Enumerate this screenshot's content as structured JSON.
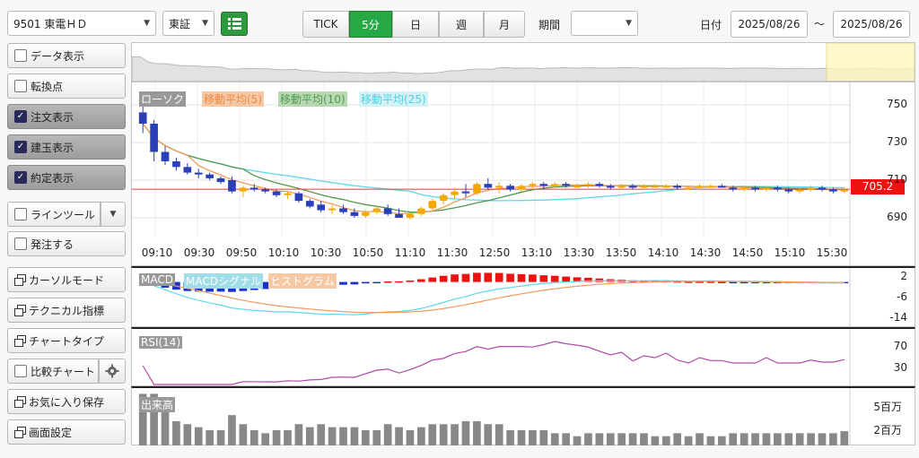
{
  "toolbar": {
    "stock_select": "9501 東電ＨＤ",
    "market_select": "東証",
    "period_label": "期間",
    "period_select": "",
    "date_label": "日付",
    "date_from": "2025/08/26",
    "date_sep": "〜",
    "date_to": "2025/08/26",
    "interval_tabs": [
      {
        "label": "TICK",
        "active": false
      },
      {
        "label": "5分",
        "active": true
      },
      {
        "label": "日",
        "active": false
      },
      {
        "label": "週",
        "active": false
      },
      {
        "label": "月",
        "active": false
      }
    ]
  },
  "sidebar": {
    "data_display": "データ表示",
    "turning_point": "転換点",
    "order_display": "注文表示",
    "position_display": "建玉表示",
    "execution_display": "約定表示",
    "line_tool": "ラインツール",
    "place_order": "発注する",
    "cursor_mode": "カーソルモード",
    "technical_indicator": "テクニカル指標",
    "chart_type": "チャートタイプ",
    "compare_chart": "比較チャート",
    "save_favorite": "お気に入り保存",
    "screen_settings": "画面設定"
  },
  "colors": {
    "up": "#f5a800",
    "down": "#2b3fb8",
    "ma5": "#f39a5a",
    "ma10": "#4e9a4e",
    "ma25": "#5fd8e8",
    "price_line": "#e03a3a",
    "rsi": "#b04aa6",
    "volume": "#888888"
  },
  "chart_data": [
    {
      "type": "candlestick",
      "title": "",
      "legend": [
        "ローソク",
        "移動平均(5)",
        "移動平均(10)",
        "移動平均(25)"
      ],
      "x_ticks": [
        "09:10",
        "09:30",
        "09:50",
        "10:10",
        "10:30",
        "10:50",
        "11:10",
        "11:30",
        "12:50",
        "13:10",
        "13:30",
        "13:50",
        "14:10",
        "14:30",
        "14:50",
        "15:10",
        "15:30"
      ],
      "y_ticks": [
        750,
        730,
        710,
        690
      ],
      "ylim": [
        680,
        760
      ],
      "current_price": "705.2",
      "ohlc": [
        [
          746,
          750,
          735,
          740
        ],
        [
          740,
          742,
          720,
          725
        ],
        [
          725,
          728,
          718,
          720
        ],
        [
          720,
          722,
          715,
          717
        ],
        [
          717,
          719,
          713,
          714
        ],
        [
          714,
          716,
          711,
          713
        ],
        [
          713,
          714,
          710,
          711
        ],
        [
          711,
          712,
          708,
          709
        ],
        [
          710,
          712,
          703,
          704
        ],
        [
          704,
          707,
          701,
          706
        ],
        [
          706,
          708,
          704,
          705
        ],
        [
          705,
          706,
          703,
          704
        ],
        [
          704,
          705,
          701,
          702
        ],
        [
          702,
          704,
          700,
          703
        ],
        [
          703,
          704,
          698,
          699
        ],
        [
          699,
          700,
          695,
          696
        ],
        [
          697,
          699,
          693,
          694
        ],
        [
          694,
          697,
          692,
          695
        ],
        [
          695,
          697,
          692,
          693
        ],
        [
          693,
          695,
          690,
          691
        ],
        [
          691,
          694,
          690,
          693
        ],
        [
          693,
          696,
          692,
          695
        ],
        [
          695,
          697,
          691,
          692
        ],
        [
          692,
          695,
          690,
          690
        ],
        [
          690,
          693,
          689,
          692
        ],
        [
          692,
          696,
          691,
          695
        ],
        [
          695,
          700,
          694,
          699
        ],
        [
          699,
          703,
          697,
          702
        ],
        [
          702,
          706,
          700,
          704
        ],
        [
          704,
          708,
          701,
          703
        ],
        [
          703,
          709,
          702,
          708
        ],
        [
          708,
          711,
          705,
          706
        ],
        [
          706,
          709,
          703,
          707
        ],
        [
          707,
          708,
          704,
          705
        ],
        [
          705,
          708,
          704,
          707
        ],
        [
          707,
          709,
          705,
          708
        ],
        [
          708,
          709,
          705,
          707
        ],
        [
          707,
          709,
          706,
          708
        ],
        [
          708,
          709,
          706,
          707
        ],
        [
          707,
          708,
          706,
          707
        ],
        [
          707,
          709,
          706,
          708
        ],
        [
          708,
          709,
          706,
          707
        ],
        [
          707,
          708,
          705,
          706
        ],
        [
          706,
          708,
          705,
          707
        ],
        [
          707,
          708,
          705,
          706
        ],
        [
          706,
          708,
          705,
          707
        ],
        [
          707,
          708,
          706,
          707
        ],
        [
          707,
          708,
          706,
          707
        ],
        [
          707,
          708,
          705,
          706
        ],
        [
          706,
          707,
          705,
          706
        ],
        [
          706,
          708,
          705,
          707
        ],
        [
          707,
          708,
          706,
          707
        ],
        [
          707,
          708,
          706,
          706
        ],
        [
          706,
          707,
          704,
          705
        ],
        [
          705,
          707,
          704,
          706
        ],
        [
          706,
          707,
          704,
          705
        ],
        [
          705,
          707,
          704,
          706
        ],
        [
          706,
          707,
          704,
          705
        ],
        [
          705,
          706,
          703,
          704
        ],
        [
          704,
          706,
          703,
          705
        ],
        [
          705,
          707,
          704,
          706
        ],
        [
          706,
          707,
          704,
          705
        ],
        [
          705,
          706,
          703,
          704
        ],
        [
          704,
          706,
          703,
          705
        ]
      ]
    },
    {
      "type": "bar",
      "title": "",
      "legend": [
        "MACD",
        "MACDシグナル",
        "ヒストグラム"
      ],
      "y_ticks": [
        2,
        -6,
        -14
      ],
      "ylim": [
        -16,
        4
      ]
    },
    {
      "type": "line",
      "title": "",
      "legend": [
        "RSI(14)"
      ],
      "y_ticks": [
        70,
        30
      ],
      "ylim": [
        0,
        100
      ]
    },
    {
      "type": "bar",
      "title": "",
      "legend": [
        "出来高"
      ],
      "y_ticks": [
        "5百万",
        "2百万"
      ],
      "ylim": [
        0,
        7
      ]
    }
  ]
}
